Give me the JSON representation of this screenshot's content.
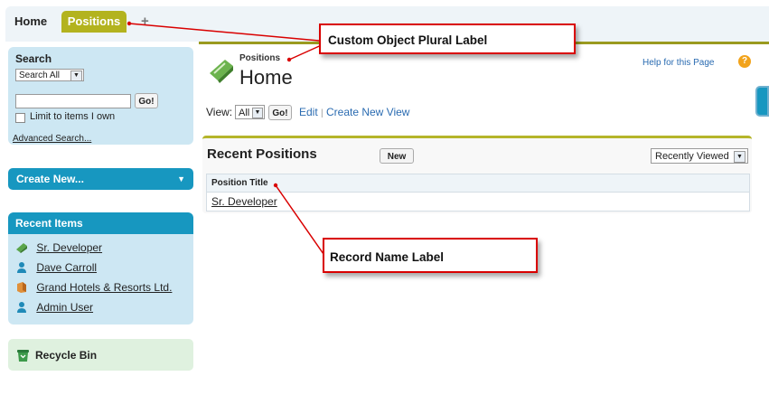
{
  "tabs": {
    "home": "Home",
    "positions": "Positions",
    "add": "+"
  },
  "sidebar": {
    "search": {
      "title": "Search",
      "scope": "Search All",
      "go": "Go!",
      "limit_label": "Limit to items I own",
      "advanced": "Advanced Search..."
    },
    "create_new": "Create New...",
    "recent": {
      "title": "Recent Items",
      "items": [
        {
          "label": "Sr. Developer",
          "icon": "position-icon"
        },
        {
          "label": "Dave Carroll",
          "icon": "user-icon"
        },
        {
          "label": "Grand Hotels & Resorts Ltd.",
          "icon": "account-icon"
        },
        {
          "label": "Admin User",
          "icon": "user-icon"
        }
      ]
    },
    "recycle_bin": "Recycle Bin"
  },
  "header": {
    "kicker": "Positions",
    "title": "Home",
    "help": "Help for this Page",
    "help_icon": "?"
  },
  "view": {
    "label": "View:",
    "selected": "All",
    "go": "Go!",
    "edit": "Edit",
    "separator": "|",
    "create_view": "Create New View"
  },
  "recent_list": {
    "title": "Recent Positions",
    "new_button": "New",
    "filter": "Recently Viewed",
    "column": "Position Title",
    "rows": [
      "Sr. Developer"
    ]
  },
  "annotations": {
    "plural": "Custom Object Plural Label",
    "record": "Record Name Label"
  },
  "colors": {
    "tab_active": "#b3b31e",
    "panel_blue": "#cde7f3",
    "header_blue": "#1797c0",
    "callout_red": "#d90000"
  }
}
